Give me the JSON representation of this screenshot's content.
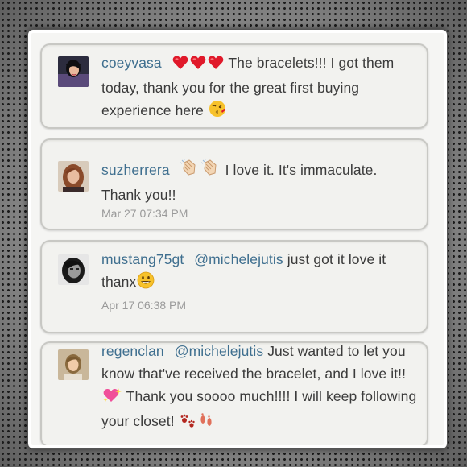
{
  "comments": [
    {
      "username": "coeyvasa",
      "mention": "",
      "text_a": "The bracelets!!! I got them today, thank you for the great first buying experience here",
      "time": "",
      "emojis_before": [
        "red-heart",
        "red-heart",
        "red-heart"
      ],
      "emojis_after": [
        "kissing-face"
      ]
    },
    {
      "username": "suzherrera",
      "mention": "",
      "text_a": "I love it. It's immaculate. Thank you!!",
      "time": "Mar 27 07:34 PM",
      "emojis_before": [
        "clapping-hands",
        "clapping-hands"
      ],
      "emojis_after": []
    },
    {
      "username": "mustang75gt",
      "mention": "@michelejutis",
      "text_a": "just got it love it thanx",
      "time": "Apr 17 06:38 PM",
      "emojis_before": [],
      "emojis_after": [
        "smiley-face"
      ]
    },
    {
      "username": "regenclan",
      "mention": "@michelejutis",
      "text_a": "Just wanted to let you know that've received the bracelet, and I love it!!",
      "text_b": "Thank you soooo much!!!! I will keep following your closet!",
      "time": "",
      "emojis_mid": [
        "sparkling-heart"
      ],
      "emojis_after": [
        "paw-prints",
        "footprints"
      ]
    }
  ],
  "colors": {
    "link": "#3f6f8f",
    "text": "#3b3b3b",
    "time": "#9a9a9a",
    "heart": "#e0192a"
  }
}
